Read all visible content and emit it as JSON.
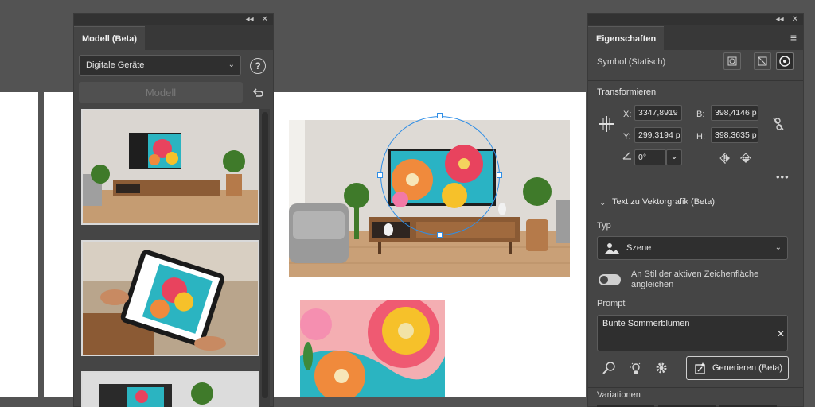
{
  "model_panel": {
    "title": "Modell (Beta)",
    "device_select": "Digitale Geräte",
    "model_button": "Modell"
  },
  "properties_panel": {
    "title": "Eigenschaften",
    "symbol_label": "Symbol (Statisch)",
    "transform": {
      "heading": "Transformieren",
      "x_label": "X:",
      "x_value": "3347,8919",
      "y_label": "Y:",
      "y_value": "299,3194 p",
      "w_label": "B:",
      "w_value": "398,4146 p",
      "h_label": "H:",
      "h_value": "398,3635 p",
      "angle_value": "0°"
    },
    "text_to_vector": {
      "heading": "Text zu Vektorgrafik (Beta)",
      "type_label": "Typ",
      "type_value": "Szene",
      "match_style_label": "An Stil der aktiven Zeichenfläche angleichen",
      "prompt_label": "Prompt",
      "prompt_value": "Bunte Sommerblumen",
      "generate_button": "Generieren (Beta)",
      "variations_label": "Variationen"
    }
  },
  "colors": {
    "workspace": "#535353",
    "panel": "#454545",
    "selection": "#2f8ee6"
  }
}
